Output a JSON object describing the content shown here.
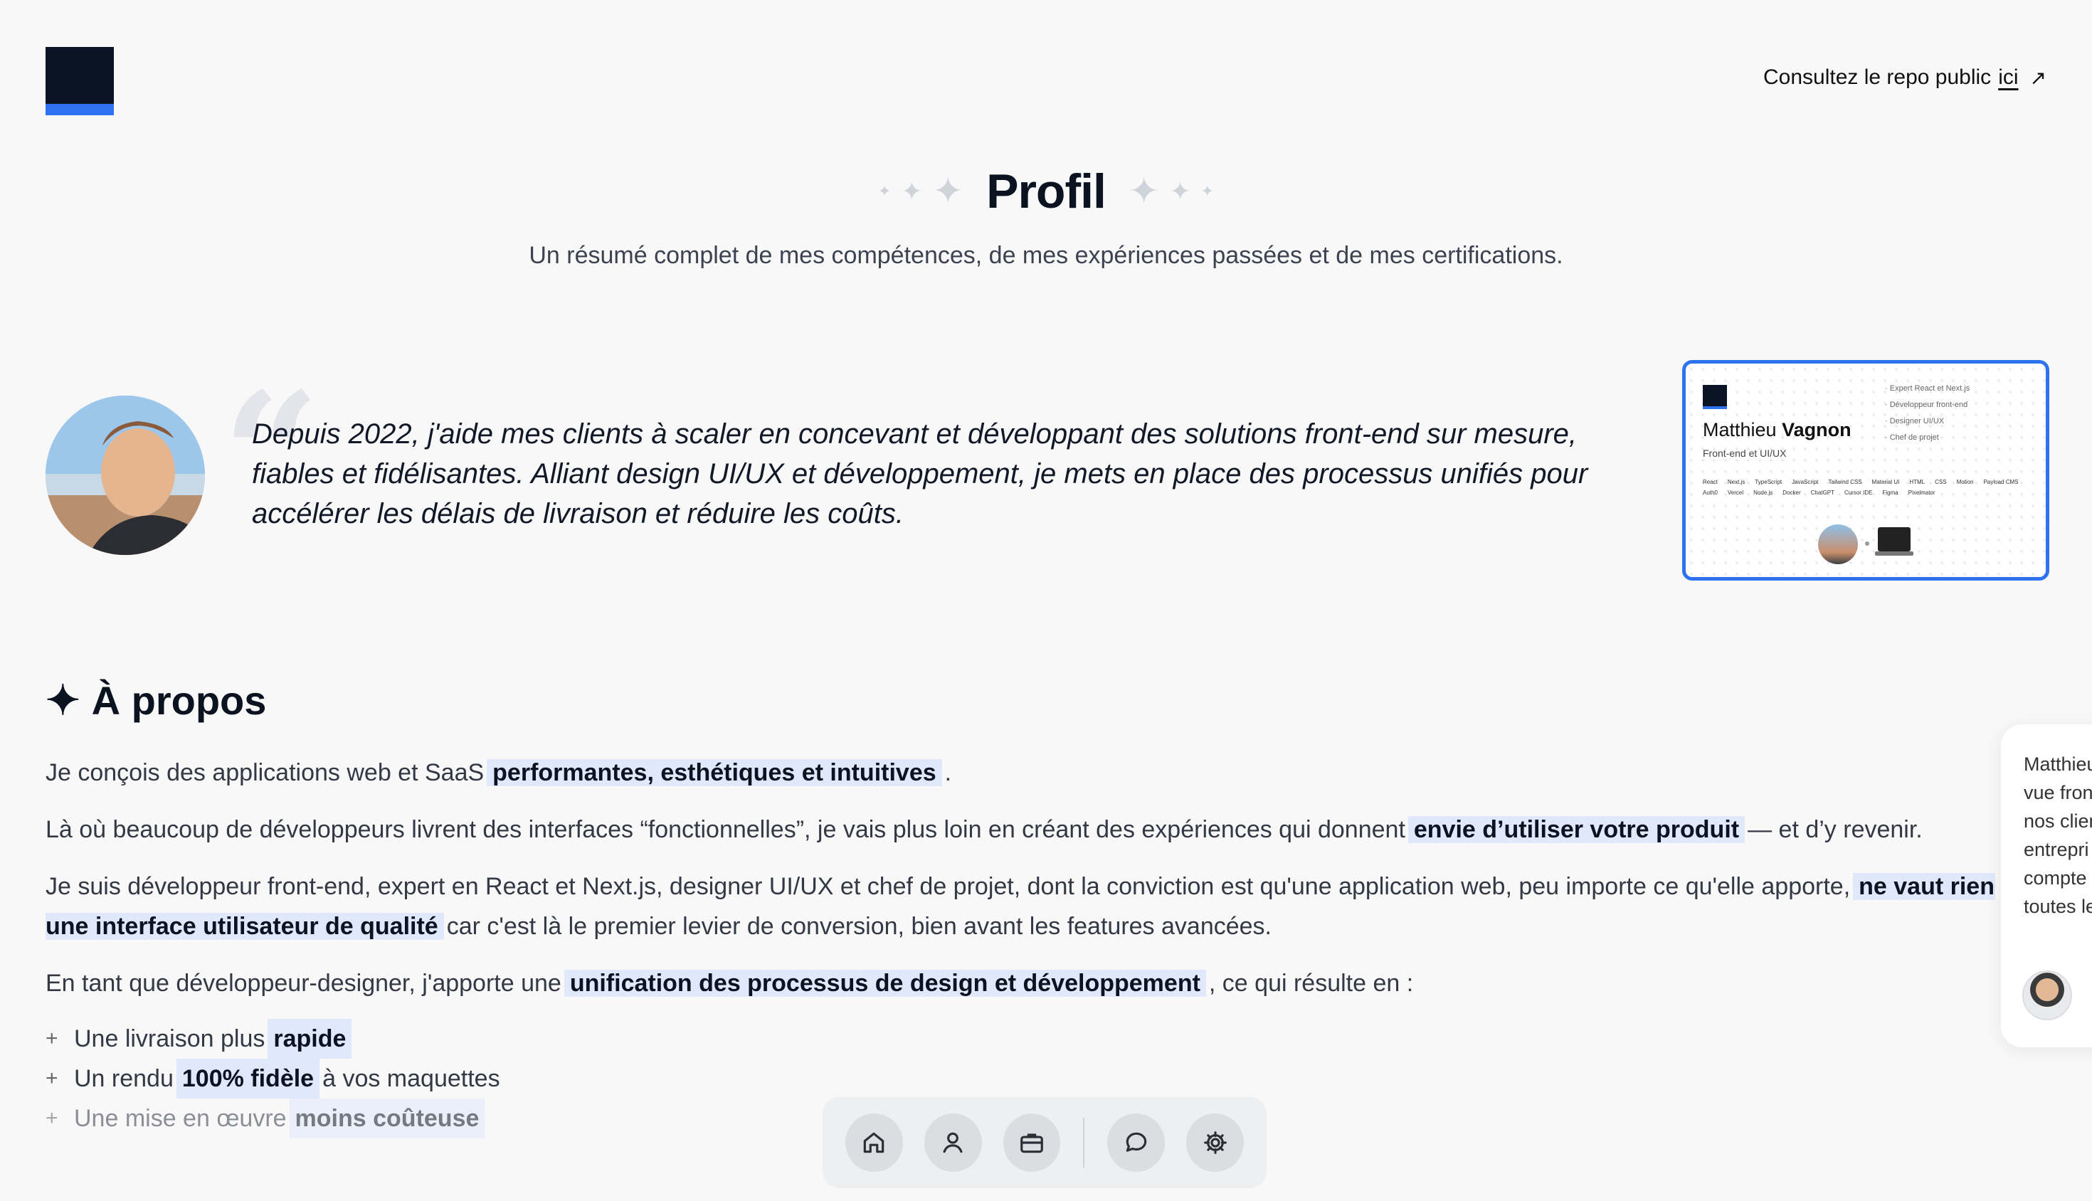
{
  "header": {
    "repo_text": "Consultez le repo public",
    "repo_link": "ici",
    "repo_arrow": "↗"
  },
  "hero": {
    "title": "Profil",
    "subtitle": "Un résumé complet de mes compétences, de mes expériences passées et de mes certifications."
  },
  "quote": {
    "text": "Depuis 2022, j'aide mes clients à scaler en concevant et développant des solutions front-end sur mesure, fiables et fidélisantes. Alliant design UI/UX et développement, je mets en place des processus unifiés pour accélérer les délais de livraison et réduire les coûts."
  },
  "card": {
    "first_name": "Matthieu",
    "last_name": "Vagnon",
    "role": "Front-end et UI/UX",
    "list": [
      "Expert React et Next.js",
      "Développeur front-end",
      "Designer UI/UX",
      "Chef de projet"
    ],
    "tags": [
      "React",
      "Next.js",
      "TypeScript",
      "JavaScript",
      "Tailwind CSS",
      "Material UI",
      "HTML",
      "CSS",
      "Motion",
      "Payload CMS",
      "Auth0",
      "Vercel",
      "Node.js",
      "Docker",
      "ChatGPT",
      "Cursor IDE",
      "Figma",
      "Pixelmator"
    ]
  },
  "about": {
    "heading": "À propos",
    "p1_a": "Je conçois des applications web et SaaS",
    "p1_hl": "performantes, esthétiques et intuitives",
    "p1_b": ".",
    "p2_a": "Là où beaucoup de développeurs livrent des interfaces “fonctionnelles”, je vais plus loin en créant des expériences qui donnent",
    "p2_hl": "envie d’utiliser votre produit",
    "p2_b": "— et d’y revenir.",
    "p3_a": "Je suis développeur front-end, expert en React et Next.js, designer UI/UX et chef de projet, dont la conviction est qu'une application web, peu importe ce qu'elle apporte,",
    "p3_hl1": "ne vaut rien s",
    "p3_hl2": "une interface utilisateur de qualité",
    "p3_b": "car c'est là le premier levier de conversion, bien avant les features avancées.",
    "p4_a": "En tant que développeur-designer, j'apporte une",
    "p4_hl": "unification des processus de design et développement",
    "p4_b": ", ce qui résulte en :",
    "bullets": [
      {
        "a": "Une livraison plus",
        "hl": "rapide",
        "b": ""
      },
      {
        "a": "Un rendu",
        "hl": "100% fidèle",
        "b": "à vos maquettes"
      },
      {
        "a": "Une mise en œuvre",
        "hl": "moins coûteuse",
        "b": ""
      }
    ]
  },
  "testimonial": {
    "lines": [
      "Matthieu",
      "vue fron",
      "nos clien",
      "entrepri",
      "compte",
      "toutes le"
    ]
  },
  "dock": {
    "items": [
      "home-icon",
      "user-icon",
      "briefcase-icon",
      "chat-icon",
      "settings-icon"
    ]
  },
  "colors": {
    "accent": "#2f72f0",
    "highlight": "#dfe9fb",
    "logo": "#0a1424"
  }
}
